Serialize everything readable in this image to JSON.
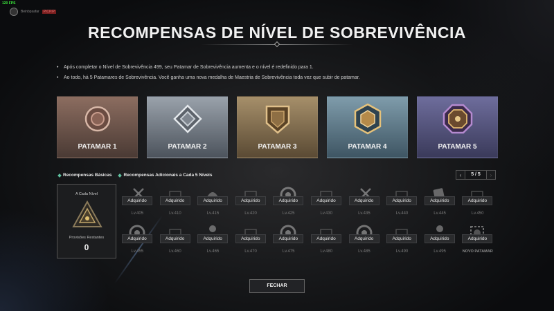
{
  "hud": {
    "fps": "120 FPS",
    "username": "Beinbpsafar",
    "user_tag": "PICPIP"
  },
  "title": "RECOMPENSAS DE NÍVEL DE SOBREVIVÊNCIA",
  "info": [
    "Após completar o Nível de Sobrevivência 499, seu Patamar de Sobrevivência aumenta e o nível é redefinido para 1.",
    "Ao todo, há 5 Patamares de Sobrevivência. Você ganha uma nova medalha de Maestria de Sobrevivência toda vez que subir de patamar."
  ],
  "tiers": [
    {
      "label": "PATAMAR 1"
    },
    {
      "label": "PATAMAR 2"
    },
    {
      "label": "PATAMAR 3"
    },
    {
      "label": "PATAMAR 4"
    },
    {
      "label": "PATAMAR 5"
    }
  ],
  "tabs": {
    "basic": "Recompensas Básicas",
    "extra": "Recompensas Adicionais a Cada 5 Níveis"
  },
  "pager": {
    "value": "5 / 5"
  },
  "left_card": {
    "heading": "A Cada Nível",
    "remaining_label": "Provisões Restantes",
    "remaining_value": "0"
  },
  "acquired_label": "Adquirido",
  "rewards_row1": [
    {
      "level": "Lv.405",
      "icon": "weapon-icon"
    },
    {
      "level": "Lv.410",
      "icon": "crate-icon"
    },
    {
      "level": "Lv.415",
      "icon": "helmet-icon"
    },
    {
      "level": "Lv.420",
      "icon": "crate-icon"
    },
    {
      "level": "Lv.425",
      "icon": "emblem-icon"
    },
    {
      "level": "Lv.430",
      "icon": "crate-icon"
    },
    {
      "level": "Lv.435",
      "icon": "weapon-icon"
    },
    {
      "level": "Lv.440",
      "icon": "crate-icon"
    },
    {
      "level": "Lv.445",
      "icon": "card-icon"
    },
    {
      "level": "Lv.450",
      "icon": "crate-icon"
    }
  ],
  "rewards_row2": [
    {
      "level": "Lv.455",
      "icon": "emblem-icon"
    },
    {
      "level": "Lv.460",
      "icon": "crate-icon"
    },
    {
      "level": "Lv.465",
      "icon": "character-icon"
    },
    {
      "level": "Lv.470",
      "icon": "crate-icon"
    },
    {
      "level": "Lv.475",
      "icon": "emblem-icon"
    },
    {
      "level": "Lv.480",
      "icon": "crate-icon"
    },
    {
      "level": "Lv.485",
      "icon": "emblem-icon"
    },
    {
      "level": "Lv.490",
      "icon": "crate-icon"
    },
    {
      "level": "Lv.495",
      "icon": "character-icon"
    },
    {
      "level": "NOVO PATAMAR",
      "icon": "medal-icon"
    }
  ],
  "close_label": "FECHAR"
}
